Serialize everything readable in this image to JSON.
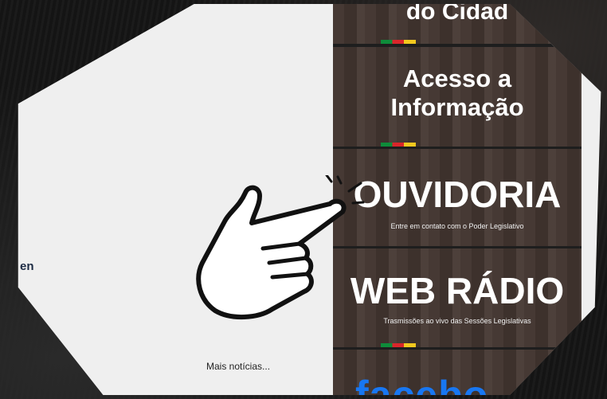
{
  "left": {
    "partial_text": "en",
    "more_news_link": "Mais notícias..."
  },
  "banners": [
    {
      "title": "do Cidad"
    },
    {
      "title_line1": "Acesso a",
      "title_line2": "Informação"
    },
    {
      "title": "OUVIDORIA",
      "subtitle": "Entre em contato com o Poder Legislativo"
    },
    {
      "title": "WEB RÁDIO",
      "subtitle": "Trasmissões ao vivo das Sessões Legislativas"
    },
    {
      "title": "facebo"
    }
  ],
  "colors": {
    "panel_bg": "#efefef",
    "flag_green": "#0e8c3a",
    "flag_red": "#d9262b",
    "flag_yellow": "#f2c81e",
    "facebook_blue": "#1877f2"
  },
  "icons": {
    "pointer": "pointing-hand-icon"
  }
}
